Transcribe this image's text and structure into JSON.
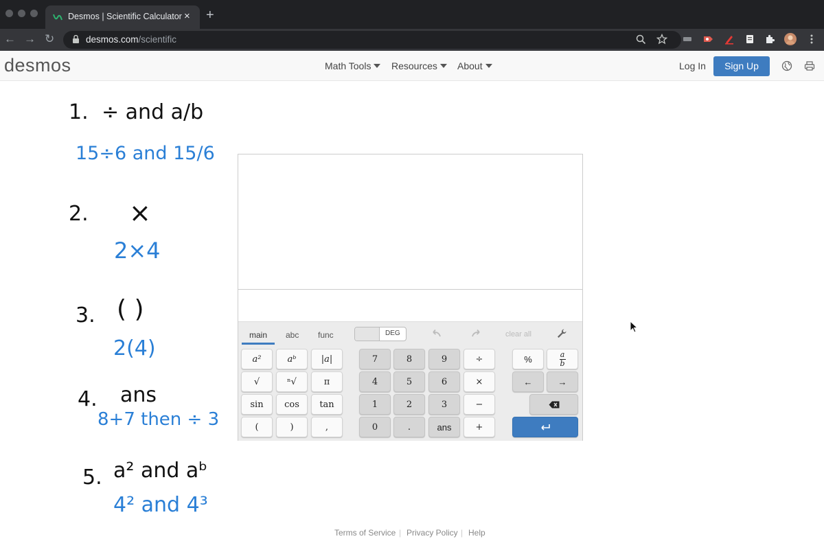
{
  "browser": {
    "tab_title": "Desmos | Scientific Calculator",
    "tab_close": "×",
    "new_tab": "+",
    "url_host": "desmos.com",
    "url_path": "/scientific",
    "back": "←",
    "forward": "→",
    "reload": "↻"
  },
  "header": {
    "logo": "desmos",
    "menus": [
      "Math Tools",
      "Resources",
      "About"
    ],
    "login": "Log In",
    "signup": "Sign Up"
  },
  "notes": {
    "items": [
      {
        "number": "1.",
        "topic": "÷ and a/b",
        "example": "15÷6 and 15/6"
      },
      {
        "number": "2.",
        "topic": "×",
        "example": "2×4"
      },
      {
        "number": "3.",
        "topic": "(  )",
        "example": "2(4)"
      },
      {
        "number": "4.",
        "topic": "ans",
        "example": "8+7 then ÷ 3"
      },
      {
        "number": "5.",
        "topic": "a² and aᵇ",
        "example": "4² and 4³"
      }
    ]
  },
  "calculator": {
    "tabs": [
      "main",
      "abc",
      "func"
    ],
    "angle_mode": "DEG",
    "clear_all": "clear all",
    "keys": {
      "row1": [
        "a²",
        "aᵇ",
        "|a|",
        "7",
        "8",
        "9",
        "÷",
        "%",
        "a/b"
      ],
      "row2": [
        "√",
        "ⁿ√",
        "π",
        "4",
        "5",
        "6",
        "×",
        "←",
        "→"
      ],
      "row3": [
        "sin",
        "cos",
        "tan",
        "1",
        "2",
        "3",
        "−",
        "⌫"
      ],
      "row4": [
        "(",
        ")",
        ",",
        "0",
        ".",
        "ans",
        "+",
        "↵"
      ]
    }
  },
  "footer": {
    "links": [
      "Terms of Service",
      "Privacy Policy",
      "Help"
    ]
  },
  "colors": {
    "accent": "#3e7cc0",
    "handwriting_blue": "#2a7fd6"
  }
}
